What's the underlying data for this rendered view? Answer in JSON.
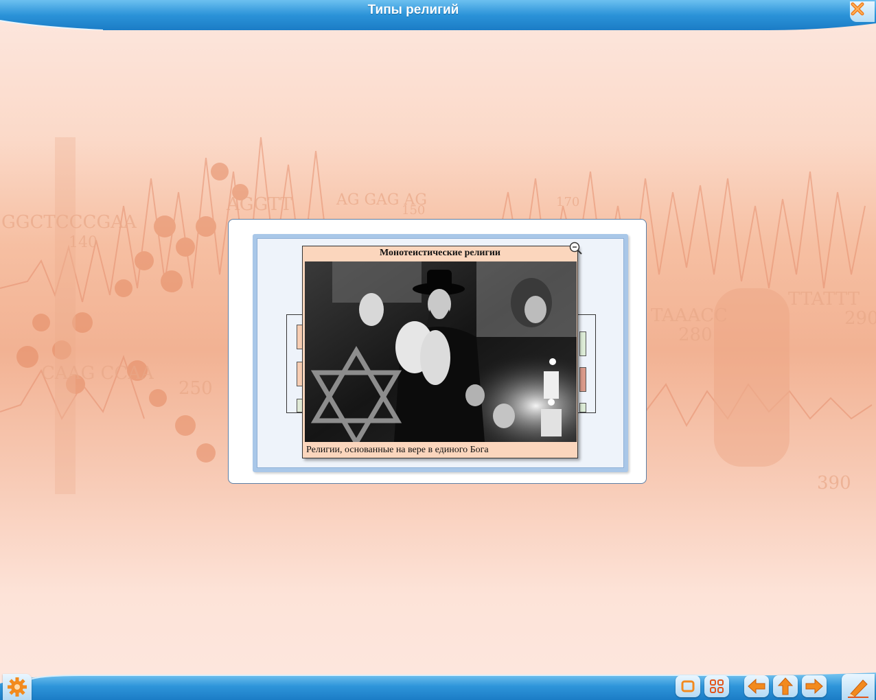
{
  "window": {
    "title": "Типы религий"
  },
  "background": {
    "sequence_text": [
      "GGCTCCCGAA",
      "AGGTT",
      "AG GAG AG",
      "140",
      "CAAG CCAA",
      "250",
      "TAAACC",
      "TTATTT",
      "280",
      "290",
      "390",
      "150",
      "170"
    ]
  },
  "popup": {
    "title": "Монотеистические религии",
    "caption": "Религии, основанные на вере в единого Бога",
    "photo_description_icon": "photo-image"
  },
  "colors": {
    "titlebar": "#2b8fd6",
    "popup_bg": "#fbd6bd",
    "frame_border": "#a9c7e8",
    "accent_orange": "#f28a1e"
  },
  "bottom_buttons": {
    "settings": "gear-icon",
    "window": "window-icon",
    "grid": "grid-icon",
    "back": "arrow-left-icon",
    "up": "arrow-up-icon",
    "forward": "arrow-right-icon",
    "pencil": "pencil-icon"
  }
}
